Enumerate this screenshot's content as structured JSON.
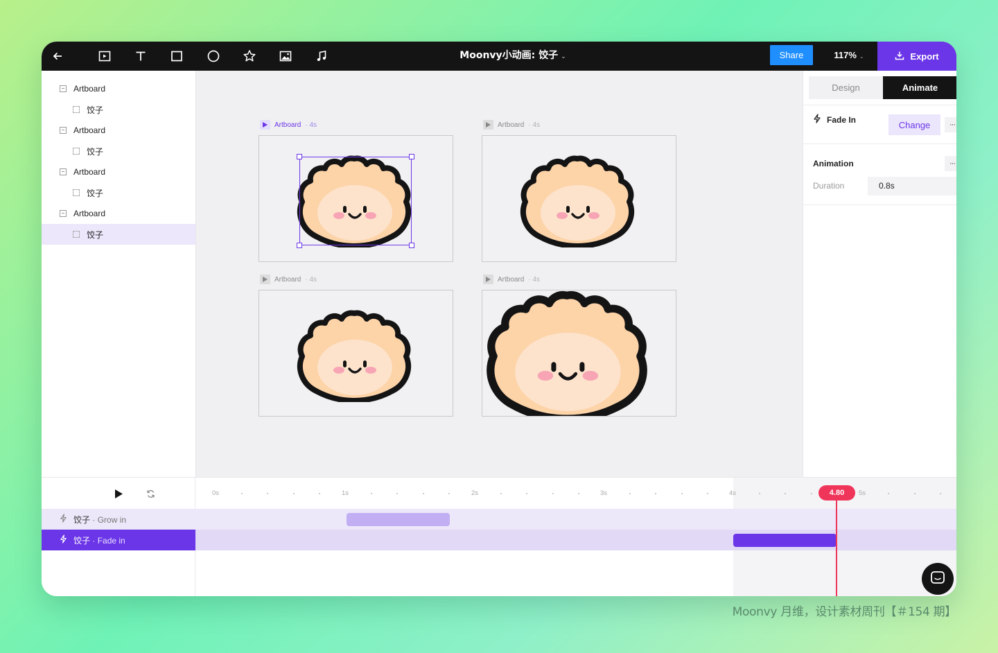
{
  "topbar": {
    "title": "Moonvy小动画: 饺子",
    "title_caret": "⌄",
    "share_label": "Share",
    "zoom": "117%",
    "zoom_caret": "⌄",
    "export_label": "Export",
    "tools": [
      "back-arrow-icon",
      "frame-tool-icon",
      "text-tool-icon",
      "rectangle-tool-icon",
      "ellipse-tool-icon",
      "star-tool-icon",
      "image-tool-icon",
      "audio-tool-icon"
    ]
  },
  "layers": [
    {
      "label": "Artboard",
      "kind": "group"
    },
    {
      "label": "饺子",
      "kind": "element"
    },
    {
      "label": "Artboard",
      "kind": "group"
    },
    {
      "label": "饺子",
      "kind": "element"
    },
    {
      "label": "Artboard",
      "kind": "group"
    },
    {
      "label": "饺子",
      "kind": "element"
    },
    {
      "label": "Artboard",
      "kind": "group"
    },
    {
      "label": "饺子",
      "kind": "element",
      "selected": true
    }
  ],
  "artboards": [
    {
      "name": "Artboard",
      "duration": "· 4s",
      "active": true
    },
    {
      "name": "Artboard",
      "duration": "· 4s",
      "active": false
    },
    {
      "name": "Artboard",
      "duration": "· 4s",
      "active": false
    },
    {
      "name": "Artboard",
      "duration": "· 4s",
      "active": false
    }
  ],
  "right_panel": {
    "tabs": {
      "design": "Design",
      "animate": "Animate",
      "active": "Animate"
    },
    "effect_label": "Fade In",
    "change_label": "Change",
    "more_label": "···",
    "animation_heading": "Animation",
    "duration_label": "Duration",
    "duration_value": "0.8s"
  },
  "timeline": {
    "ruler_labels": [
      "0s",
      "1s",
      "2s",
      "3s",
      "4s",
      "5s"
    ],
    "playhead": "4.80",
    "tracks": [
      {
        "name": "饺子",
        "effect": "· Grow in",
        "selected": false
      },
      {
        "name": "饺子",
        "effect": "· Fade in",
        "selected": true
      }
    ]
  },
  "footer": "Moonvy 月维，设计素材周刊【＃154 期】",
  "colors": {
    "accent": "#6b35e8",
    "share": "#1f8fff",
    "playhead": "#f0355a",
    "dumpling": "#fdd3a8",
    "dumpling_belly": "#fde3cc",
    "outline": "#141414",
    "blush": "#f7a5b5"
  }
}
